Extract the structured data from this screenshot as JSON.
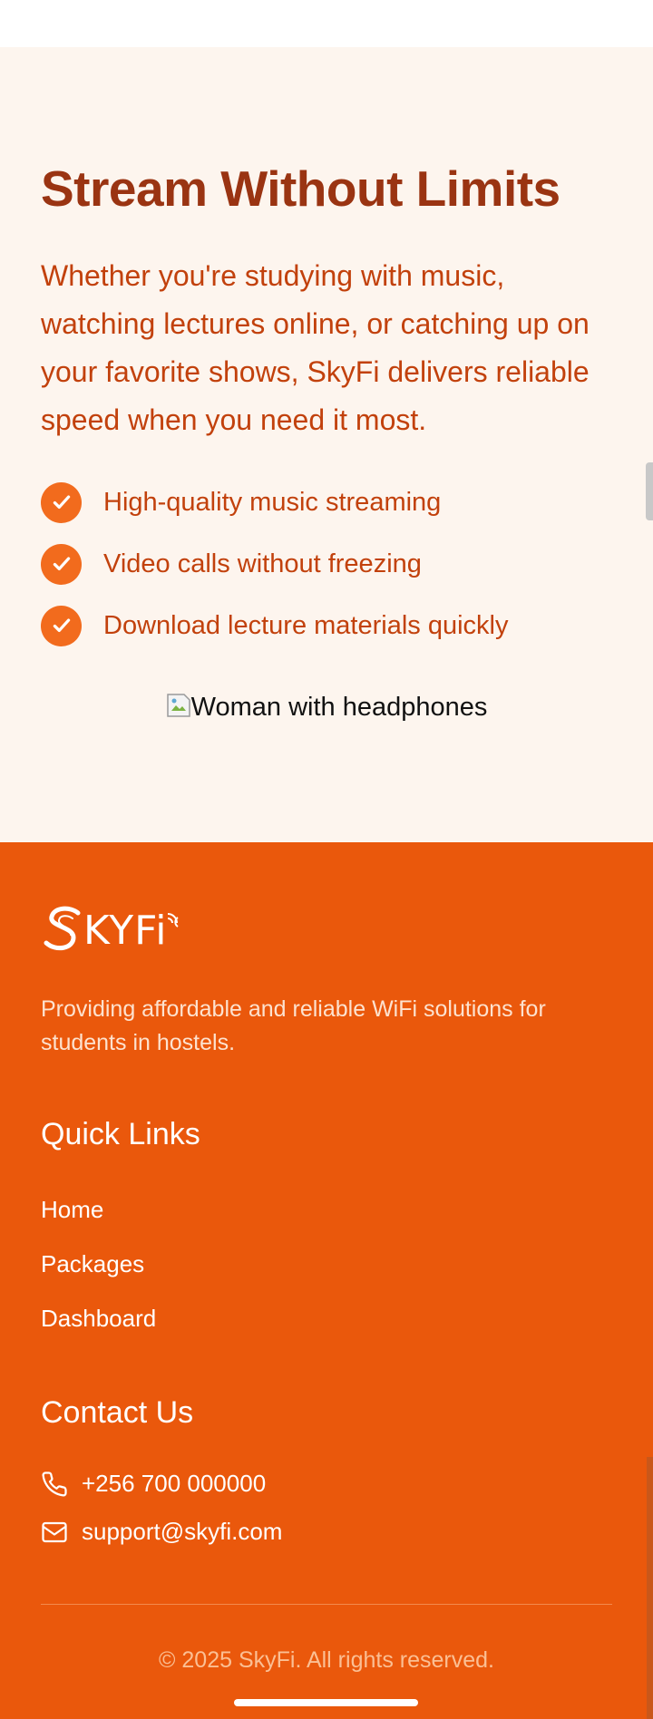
{
  "stream": {
    "title": "Stream Without Limits",
    "description": "Whether you're studying with music, watching lectures online, or catching up on your favorite shows, SkyFi delivers reliable speed when you need it most.",
    "features": [
      "High-quality music streaming",
      "Video calls without freezing",
      "Download lecture materials quickly"
    ],
    "image_alt": "Woman with headphones"
  },
  "footer": {
    "logo_text": "SKYFi",
    "tagline": "Providing affordable and reliable WiFi solutions for students in hostels.",
    "quick_links_heading": "Quick Links",
    "quick_links": [
      "Home",
      "Packages",
      "Dashboard"
    ],
    "contact_heading": "Contact Us",
    "phone": "+256 700 000000",
    "email": "support@skyfi.com",
    "copyright": "© 2025 SkyFi. All rights reserved."
  },
  "icons": {
    "feature": "check-circle-icon",
    "phone": "phone-icon",
    "email": "mail-icon",
    "broken_image": "broken-image-icon"
  },
  "colors": {
    "section_bg": "#fdf5ee",
    "heading": "#9a3412",
    "body_text": "#c2410c",
    "accent": "#f26b1d",
    "footer_bg": "#ea580c"
  }
}
